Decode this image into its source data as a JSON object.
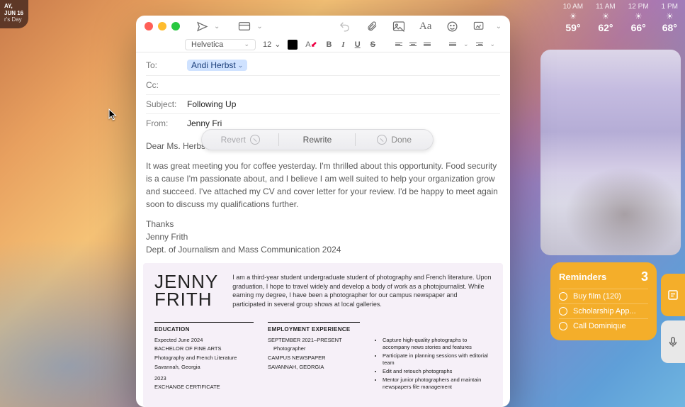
{
  "calendar": {
    "day": "AY, JUN 16",
    "event": "r's Day"
  },
  "weather": {
    "hours": [
      {
        "time": "10 AM",
        "temp": "59°"
      },
      {
        "time": "11 AM",
        "temp": "62°"
      },
      {
        "time": "12 PM",
        "temp": "66°"
      },
      {
        "time": "1 PM",
        "temp": "68°"
      }
    ]
  },
  "reminders": {
    "title": "Reminders",
    "count": "3",
    "items": [
      {
        "label": "Buy film (120)"
      },
      {
        "label": "Scholarship App..."
      },
      {
        "label": "Call Dominique"
      }
    ]
  },
  "mail": {
    "format": {
      "font": "Helvetica",
      "size": "12"
    },
    "fields": {
      "to_label": "To:",
      "to_value": "Andi Herbst",
      "cc_label": "Cc:",
      "subject_label": "Subject:",
      "subject_value": "Following Up",
      "from_label": "From:",
      "from_value": "Jenny Fri"
    },
    "rewrite": {
      "revert": "Revert",
      "rewrite": "Rewrite",
      "done": "Done"
    },
    "body": {
      "greeting": "Dear Ms. Herbst,",
      "para1": "It was great meeting you for coffee yesterday. I'm thrilled about this opportunity. Food security is a cause I'm passionate about, and I believe I am well suited to help your organization grow and succeed. I've attached my CV and cover letter for your review. I'd be happy to meet again soon to discuss my qualifications further.",
      "thanks": "Thanks",
      "sig_name": "Jenny Frith",
      "sig_dept": "Dept. of Journalism and Mass Communication 2024"
    },
    "resume": {
      "name_first": "JENNY",
      "name_last": "FRITH",
      "bio": "I am a third-year student undergraduate student of photography and French literature. Upon graduation, I hope to travel widely and develop a body of work as a photojournalist. While earning my degree, I have been a photographer for our campus newspaper and participated in several group shows at local galleries.",
      "edu_hd": "EDUCATION",
      "edu1a": "Expected June 2024",
      "edu1b": "BACHELOR OF FINE ARTS",
      "edu1c": "Photography and French Literature",
      "edu1d": "Savannah, Georgia",
      "edu2a": "2023",
      "edu2b": "EXCHANGE CERTIFICATE",
      "emp_hd": "EMPLOYMENT EXPERIENCE",
      "emp1a": "SEPTEMBER 2021–PRESENT",
      "emp1b": "Photographer",
      "emp1c": "CAMPUS NEWSPAPER",
      "emp1d": "SAVANNAH, GEORGIA",
      "bul1": "Capture high-quality photographs to accompany news stories and features",
      "bul2": "Participate in planning sessions with editorial team",
      "bul3": "Edit and retouch photographs",
      "bul4": "Mentor junior photographers and maintain newspapers file management"
    }
  }
}
